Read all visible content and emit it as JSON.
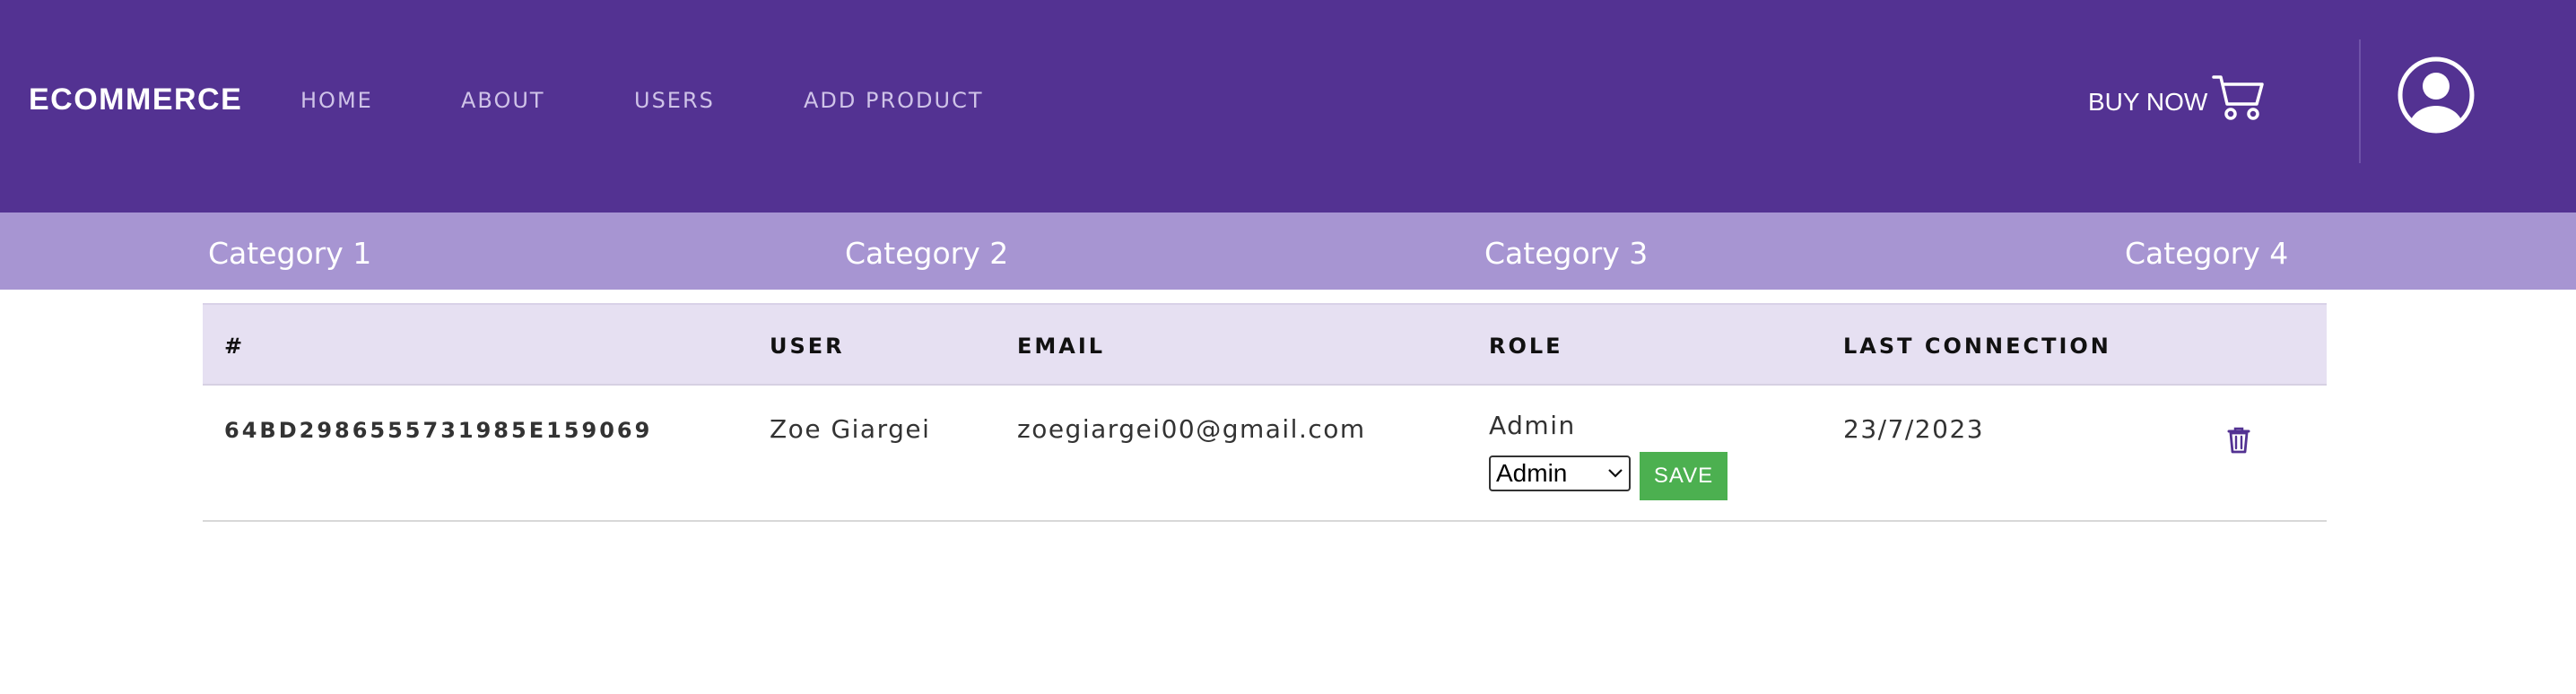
{
  "navbar": {
    "brand": "ECOMMERCE",
    "links": [
      "HOME",
      "ABOUT",
      "USERS",
      "ADD PRODUCT"
    ],
    "buy_now": "BUY NOW",
    "cart_icon": "shopping-cart-icon",
    "avatar_icon": "user-circle-icon",
    "background": "#533292"
  },
  "categories": [
    "Category 1",
    "Category 2",
    "Category 3",
    "Category 4"
  ],
  "table": {
    "headers": [
      "#",
      "USER",
      "EMAIL",
      "ROLE",
      "LAST CONNECTION"
    ],
    "rows": [
      {
        "id": "64BD2986555731985E159069",
        "user": "Zoe Giargei",
        "email": "zoegiargei00@gmail.com",
        "role": "Admin",
        "role_select": "Admin",
        "save_label": "SAVE",
        "last_connection": "23/7/2023",
        "delete_icon": "trash-icon"
      }
    ]
  },
  "colors": {
    "primary": "#533292",
    "category_bar": "#a795d2",
    "header_row": "#e6e0f2",
    "save": "#4cb050"
  }
}
